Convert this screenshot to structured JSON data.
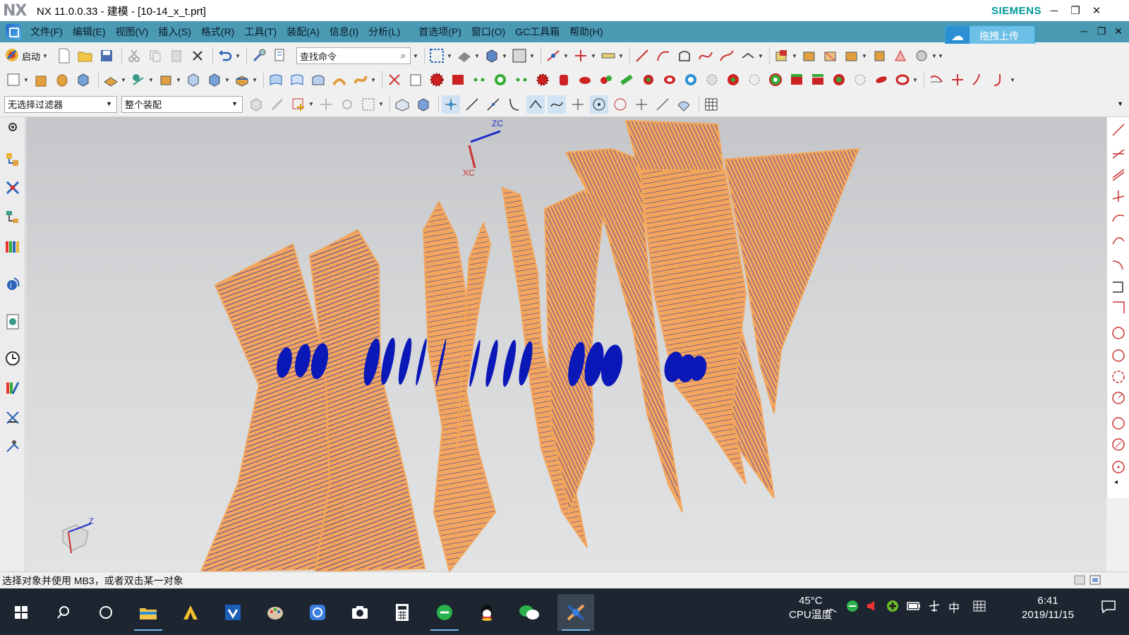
{
  "window": {
    "logo": "NX",
    "title": "NX 11.0.0.33 - 建模 - [10-14_x_t.prt]",
    "brand": "SIEMENS",
    "controls": {
      "minimize": "─",
      "restore": "❐",
      "close": "✕"
    }
  },
  "menubar": {
    "items": [
      {
        "label": "文件(F)"
      },
      {
        "label": "编辑(E)"
      },
      {
        "label": "视图(V)"
      },
      {
        "label": "插入(S)"
      },
      {
        "label": "格式(R)"
      },
      {
        "label": "工具(T)"
      },
      {
        "label": "装配(A)"
      },
      {
        "label": "信息(I)"
      },
      {
        "label": "分析(L)"
      },
      {
        "label": "首选项(P)"
      },
      {
        "label": "窗口(O)"
      },
      {
        "label": "GC工具箱"
      },
      {
        "label": "帮助(H)"
      }
    ],
    "cloud_upload_label": "拖拽上传",
    "mdi_controls": {
      "minimize": "─",
      "restore": "❐",
      "close": "✕"
    }
  },
  "toolbar": {
    "start_label": "启动",
    "search_placeholder": "查找命令",
    "filter_select": "无选择过滤器",
    "scope_select": "整个装配"
  },
  "viewport": {
    "triad_labels": {
      "zc": "ZC",
      "xc": "XC",
      "z": "Z"
    },
    "accent_blue": "#0b18b8",
    "accent_orange": "#f4a55a"
  },
  "status": {
    "message": "选择对象并使用 MB3，或者双击某一对象"
  },
  "taskbar": {
    "apps": [
      "windows-start",
      "search",
      "cortana",
      "file-explorer",
      "autocad",
      "visio",
      "paint",
      "browser",
      "camera",
      "calculator",
      "ie",
      "qq",
      "wechat",
      "nx"
    ],
    "cpu_temp": "45°C",
    "cpu_label": "CPU温度",
    "ime_lang": "中",
    "time": "6:41",
    "date": "2019/11/15"
  }
}
